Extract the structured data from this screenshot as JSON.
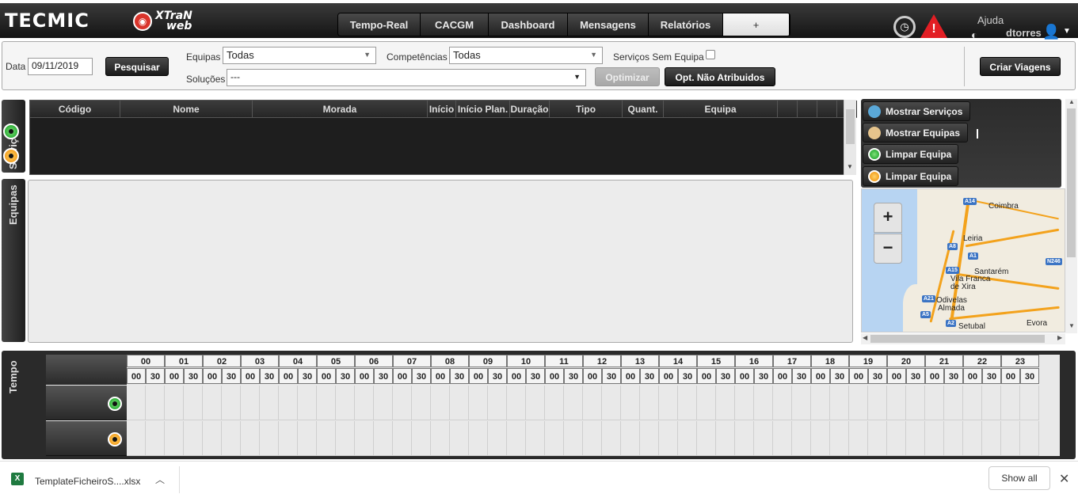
{
  "header": {
    "logo": "TECMIC",
    "brand_line1": "XTraN",
    "brand_line2": "web",
    "nav_tabs": [
      "Tempo-Real",
      "CACGM",
      "Dashboard",
      "Mensagens",
      "Relatórios",
      "+"
    ],
    "help_label": "Ajuda",
    "username": "dtorres",
    "icons": [
      "clock-icon",
      "alert-icon",
      "help-icon",
      "user-icon",
      "chevron-down-icon"
    ]
  },
  "filters": {
    "date_label": "Data",
    "date_value": "09/11/2019",
    "search_button": "Pesquisar",
    "teams_label": "Equipas",
    "teams_value": "Todas",
    "skills_label": "Competências",
    "skills_value": "Todas",
    "no_team_label": "Serviços Sem Equipa",
    "solutions_label": "Soluções",
    "solutions_value": "---",
    "optimize_button": "Optimizar",
    "opt_unassigned_button": "Opt. Não Atribuidos",
    "create_trips_button": "Criar Viagens"
  },
  "services_tab": "Serviços",
  "teams_tab": "Equipas",
  "time_tab": "Tempo",
  "grid": {
    "columns": [
      "Código",
      "Nome",
      "Morada",
      "Início",
      "Início Plan.",
      "Duração",
      "Tipo",
      "Quant.",
      "Equipa",
      "",
      "",
      ""
    ]
  },
  "right_panel": {
    "buttons": [
      "Mostrar Serviços",
      "Mostrar Equipas",
      "Limpar Equipa",
      "Limpar Equipa"
    ]
  },
  "map": {
    "cities": [
      "Coimbra",
      "Leiria",
      "Santarém",
      "Vila Franca de Xira",
      "Odivelas",
      "Almada",
      "Setubal",
      "Evora"
    ],
    "road_shields": [
      "A14",
      "A8",
      "A1",
      "A15",
      "A21",
      "A5",
      "A2",
      "N246"
    ],
    "zoom_in": "+",
    "zoom_out": "−"
  },
  "timeline": {
    "hours": [
      "00",
      "01",
      "02",
      "03",
      "04",
      "05",
      "06",
      "07",
      "08",
      "09",
      "10",
      "11",
      "12",
      "13",
      "14",
      "15",
      "16",
      "17",
      "18",
      "19",
      "20",
      "21",
      "22",
      "23"
    ],
    "minutes": [
      "00",
      "30"
    ]
  },
  "download_bar": {
    "file_name": "TemplateFicheiroS....xlsx",
    "show_all": "Show all"
  }
}
